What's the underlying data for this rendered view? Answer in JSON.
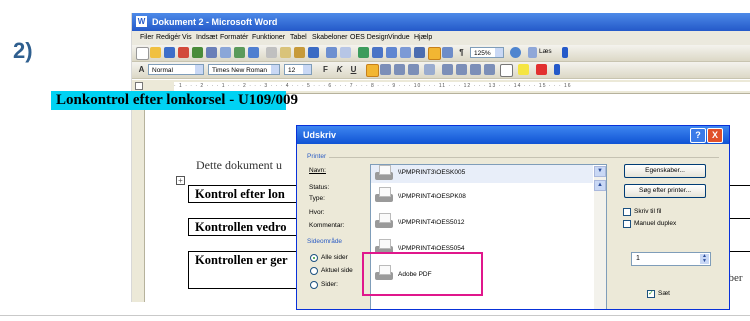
{
  "step_label": "2)",
  "window": {
    "title": "Dokument 2 - Microsoft Word",
    "icon": "word-doc-icon"
  },
  "menu": [
    "Filer",
    "Redigér",
    "Vis",
    "Indsæt",
    "Formatér",
    "Funktioner",
    "Tabel",
    "Skabeloner",
    "OES Design",
    "Vindue",
    "Hjælp"
  ],
  "toolbar": {
    "zoom": "125%",
    "read_label": "Læs",
    "style": "Normal",
    "font": "Times New Roman",
    "size": "12",
    "bold": "F",
    "italic": "K",
    "underline": "U"
  },
  "ruler_text": "· 1 · · · 2 · · · 1 · · · 2 · · · 3 · · · 4 · · · 5 · · · 6 · · · 7 · · · 8 · · · 9 · · · 10 · · · 11 · · · 12 · · · 13 · · · 14 · · · 15 · · · 16",
  "document": {
    "heading": "Lonkontrol efter lonkorsel - U109/009",
    "intro": "Dette dokument u",
    "rows": [
      "Kontrol efter lon",
      "Kontrollen vedro",
      "Kontrollen er ger"
    ],
    "right_fragment": "nber"
  },
  "dialog": {
    "title": "Udskriv",
    "printer_group": "Printer",
    "name_label": "Navn:",
    "status_label": "Status:",
    "type_label": "Type:",
    "where_label": "Hvor:",
    "comment_label": "Kommentar:",
    "selected_printer": "\\\\PMPRINT3\\OESK005",
    "printers": [
      "\\\\PMPRINT4\\OESPK08",
      "\\\\PMPRINT4\\OES5012",
      "\\\\PMPRINT4\\OES5054",
      "Adobe PDF"
    ],
    "properties_button": "Egenskaber...",
    "find_printer_button": "Søg efter printer...",
    "print_to_file": "Skriv til fil",
    "manual_duplex": "Manuel duplex",
    "page_range_group": "Sideområde",
    "all_pages": "Alle sider",
    "current_page": "Aktuel side",
    "pages": "Sider:",
    "copies_value": "1",
    "collate": "Sæt",
    "help_glyph": "?",
    "close_glyph": "X"
  }
}
